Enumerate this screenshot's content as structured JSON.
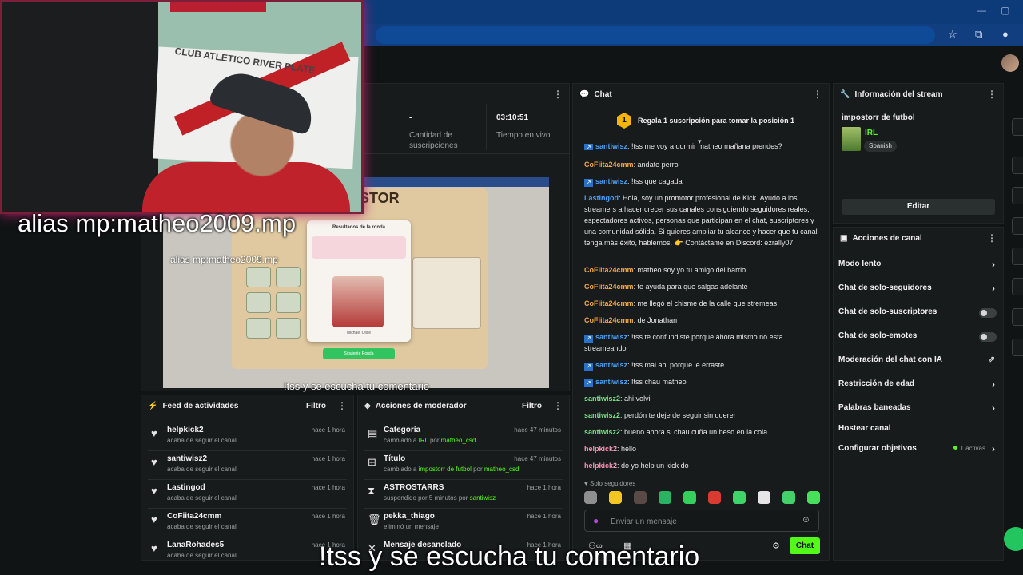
{
  "stats": {
    "subs_value": "-",
    "subs_label": "Cantidad de suscripciones",
    "live_value": "03:10:51",
    "live_label": "Tiempo en vivo"
  },
  "captions": {
    "cam_big": "alias mp:matheo2009.mp",
    "cam_small": "alias mp:matheo2009.mp",
    "sub_small": "!tss y se escucha tu comentario",
    "sub_big": "!tss y se escucha tu comentario"
  },
  "preview": {
    "card_title": "Resultados de la ronda",
    "player_name": "Michael Olise",
    "next_button": "Siguiente Ronda"
  },
  "activity_feed": {
    "title": "Feed de actividades",
    "filter": "Filtro",
    "items": [
      {
        "name": "helpkick2",
        "sub": "acaba de seguir el canal",
        "time": "hace 1 hora"
      },
      {
        "name": "santiwisz2",
        "sub": "acaba de seguir el canal",
        "time": "hace 1 hora"
      },
      {
        "name": "Lastingod",
        "sub": "acaba de seguir el canal",
        "time": "hace 1 hora"
      },
      {
        "name": "CoFiita24cmm",
        "sub": "acaba de seguir el canal",
        "time": "hace 1 hora"
      },
      {
        "name": "LanaRohades5",
        "sub": "acaba de seguir el canal",
        "time": "hace 1 hora"
      }
    ]
  },
  "mod_actions": {
    "title": "Acciones de moderador",
    "filter": "Filtro",
    "items": [
      {
        "name": "Categoría",
        "sub_pre": "cambiado a ",
        "sub_hl": "IRL",
        "sub_mid": " por ",
        "sub_user": "matheo_csd",
        "time": "hace 47 minutos"
      },
      {
        "name": "Título",
        "sub_pre": "cambiado a ",
        "sub_hl": "impostorr de futbol",
        "sub_mid": " por ",
        "sub_user": "matheo_csd",
        "time": "hace 47 minutos"
      },
      {
        "name": "ASTROSTARRS",
        "sub_pre": "suspendido por 5 minutos por ",
        "sub_hl": "",
        "sub_mid": "",
        "sub_user": "santiwisz",
        "time": "hace 1 hora"
      },
      {
        "name": "pekka_thiago",
        "sub_pre": "eliminó un mensaje",
        "sub_hl": "",
        "sub_mid": "",
        "sub_user": "",
        "time": "hace 1 hora"
      },
      {
        "name": "Mensaje desanclado",
        "sub_pre": "",
        "sub_hl": "",
        "sub_mid": "",
        "sub_user": "",
        "time": "hace 1 hora"
      }
    ]
  },
  "chat": {
    "title": "Chat",
    "pin_number": "1",
    "pin_text": "Regala 1 suscripción para tomar la posición 1",
    "messages": [
      {
        "user": "santiwisz",
        "color": "blue",
        "badge": true,
        "text": "!tss me voy a dormir matheo mañana prendes?"
      },
      {
        "user": "CoFiita24cmm",
        "color": "orange",
        "badge": false,
        "text": "andate perro"
      },
      {
        "user": "santiwisz",
        "color": "blue",
        "badge": true,
        "text": "!tss que cagada"
      },
      {
        "user": "Lastingod",
        "color": "blue",
        "badge": false,
        "text": "Hola, soy un promotor profesional de Kick. Ayudo a los streamers a hacer crecer sus canales consiguiendo seguidores reales, espectadores activos, personas que participan en el chat, suscriptores y una comunidad sólida. Si quieres ampliar tu alcance y hacer que tu canal tenga más éxito, hablemos. 👉 Contáctame en Discord: ezrally07"
      },
      {
        "user": "CoFiita24cmm",
        "color": "orange",
        "badge": false,
        "text": "matheo soy yo tu amigo del barrio"
      },
      {
        "user": "CoFiita24cmm",
        "color": "orange",
        "badge": false,
        "text": "te ayuda para que salgas adelante"
      },
      {
        "user": "CoFiita24cmm",
        "color": "orange",
        "badge": false,
        "text": "me llegó el chisme de la calle que stremeas"
      },
      {
        "user": "CoFiita24cmm",
        "color": "orange",
        "badge": false,
        "text": "de Jonathan"
      },
      {
        "user": "santiwisz",
        "color": "blue",
        "badge": true,
        "text": "!tss te confundiste porque ahora mismo no esta streameando"
      },
      {
        "user": "santiwisz",
        "color": "blue",
        "badge": true,
        "text": "!tss mal ahi porque le erraste"
      },
      {
        "user": "santiwisz",
        "color": "blue",
        "badge": true,
        "text": "!tss chau matheo"
      },
      {
        "user": "santiwisz2",
        "color": "green",
        "badge": false,
        "text": "ahi volvi"
      },
      {
        "user": "santiwisz2",
        "color": "green",
        "badge": false,
        "text": "perdón te deje de seguir sin querer"
      },
      {
        "user": "santiwisz2",
        "color": "green",
        "badge": false,
        "text": "bueno ahora si chau cuña un beso en la cola"
      },
      {
        "user": "helpkick2",
        "color": "pink",
        "badge": false,
        "text": "hello"
      },
      {
        "user": "helpkick2",
        "color": "pink",
        "badge": false,
        "text": "do yo help un kick do"
      }
    ],
    "followers_only": "Solo seguidores",
    "input_placeholder": "Enviar un mensaje",
    "send_label": "Chat"
  },
  "stream_info": {
    "title": "Información del stream",
    "stream_title": "impostorr de futbol",
    "category": "IRL",
    "language": "Spanish",
    "edit_label": "Editar"
  },
  "channel_actions": {
    "title": "Acciones de canal",
    "rows": [
      {
        "label": "Modo lento",
        "control": "chevron"
      },
      {
        "label": "Chat de solo-seguidores",
        "control": "chevron"
      },
      {
        "label": "Chat de solo-suscriptores",
        "control": "toggle"
      },
      {
        "label": "Chat de solo-emotes",
        "control": "toggle"
      },
      {
        "label": "Moderación del chat con IA",
        "control": "external"
      },
      {
        "label": "Restricción de edad",
        "control": "chevron"
      },
      {
        "label": "Palabras baneadas",
        "control": "chevron"
      },
      {
        "label": "Hostear canal",
        "control": "none"
      },
      {
        "label": "Configurar objetivos",
        "control": "chevron"
      }
    ],
    "goals_active": "1 activas"
  },
  "colors": {
    "kick_green": "#53fc18",
    "username_blue": "#4a9ff5",
    "username_orange": "#f5a742",
    "username_green": "#7ae08a",
    "username_pink": "#f596b5",
    "cam_border_glow": "#b8206b"
  }
}
